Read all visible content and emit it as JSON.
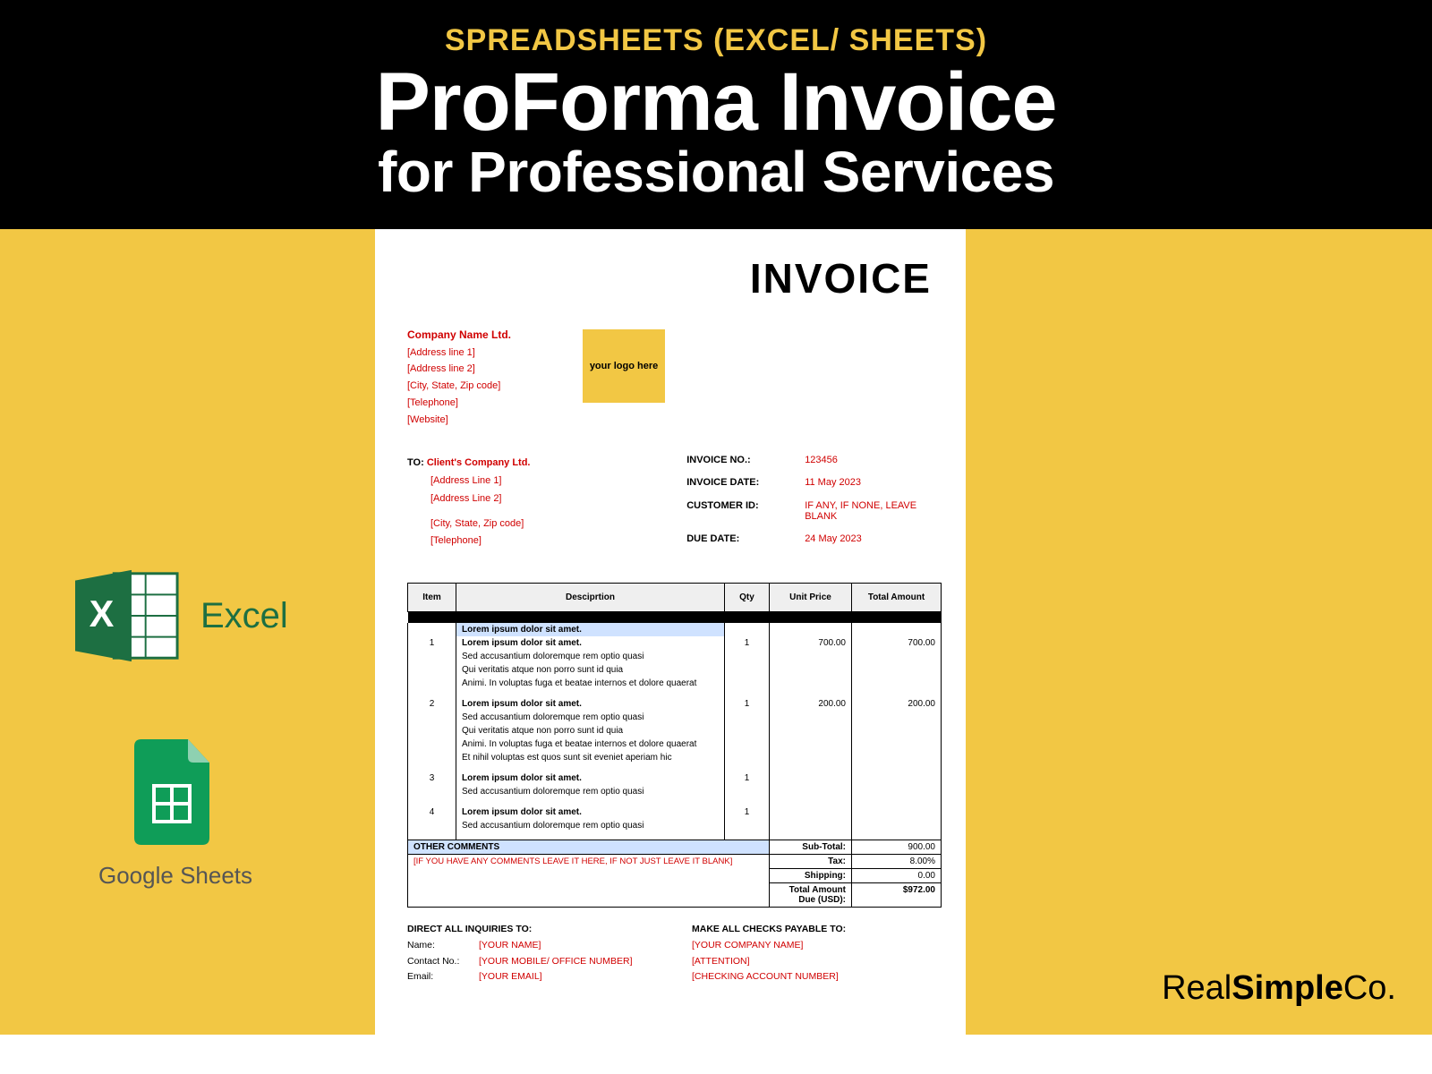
{
  "hero": {
    "eyebrow": "SPREADSHEETS (EXCEL/ SHEETS)",
    "title": "ProForma Invoice",
    "subtitle": "for Professional Services"
  },
  "badges": {
    "excel_label": "Excel",
    "sheets_label": "Google Sheets"
  },
  "invoice": {
    "heading": "INVOICE",
    "company": {
      "name": "Company Name Ltd.",
      "addr1": "[Address line 1]",
      "addr2": "[Address line 2]",
      "city": "[City, State, Zip code]",
      "tel": "[Telephone]",
      "web": "[Website]"
    },
    "logo_text": "your logo here",
    "to_label": "TO:",
    "client": {
      "name": "Client's Company Ltd.",
      "addr1": "[Address Line 1]",
      "addr2": "[Address Line 2]",
      "city": "[City, State, Zip code]",
      "tel": "[Telephone]"
    },
    "meta": {
      "inv_no_lbl": "INVOICE NO.:",
      "inv_no_val": "123456",
      "inv_date_lbl": "INVOICE DATE:",
      "inv_date_val": "11 May 2023",
      "cust_id_lbl": "CUSTOMER ID:",
      "cust_id_val": "IF ANY, IF NONE, LEAVE BLANK",
      "due_lbl": "DUE DATE:",
      "due_val": "24 May 2023"
    },
    "columns": {
      "item": "Item",
      "desc": "Desciprtion",
      "qty": "Qty",
      "price": "Unit Price",
      "total": "Total Amount"
    },
    "rows": [
      {
        "item": "1",
        "header": "Lorem ipsum dolor sit amet.",
        "lines": [
          "Lorem ipsum dolor sit amet.",
          "Sed accusantium doloremque rem optio quasi",
          "Qui veritatis atque non porro sunt id quia",
          "Animi. In voluptas fuga et beatae internos et dolore quaerat"
        ],
        "qty": "1",
        "price": "700.00",
        "total": "700.00"
      },
      {
        "item": "2",
        "header": "Lorem ipsum dolor sit amet.",
        "lines": [
          "Sed accusantium doloremque rem optio quasi",
          "Qui veritatis atque non porro sunt id quia",
          "Animi. In voluptas fuga et beatae internos et dolore quaerat",
          "Et nihil voluptas est quos sunt sit eveniet aperiam hic"
        ],
        "qty": "1",
        "price": "200.00",
        "total": "200.00"
      },
      {
        "item": "3",
        "header": "Lorem ipsum dolor sit amet.",
        "lines": [
          "Sed accusantium doloremque rem optio quasi"
        ],
        "qty": "1",
        "price": "",
        "total": ""
      },
      {
        "item": "4",
        "header": "Lorem ipsum dolor sit amet.",
        "lines": [
          "Sed accusantium doloremque rem optio quasi"
        ],
        "qty": "1",
        "price": "",
        "total": ""
      }
    ],
    "comments_lbl": "OTHER COMMENTS",
    "comments_text": "[IF YOU HAVE ANY COMMENTS LEAVE IT HERE, IF NOT JUST LEAVE IT BLANK]",
    "totals": {
      "subtotal_lbl": "Sub-Total:",
      "subtotal_val": "900.00",
      "tax_lbl": "Tax:",
      "tax_val": "8.00%",
      "ship_lbl": "Shipping:",
      "ship_val": "0.00",
      "due_lbl": "Total Amount Due (USD):",
      "due_val": "$972.00"
    },
    "footer": {
      "inq_heading": "DIRECT ALL INQUIRIES TO:",
      "inq_name_lbl": "Name:",
      "inq_name_val": "[YOUR NAME]",
      "inq_contact_lbl": "Contact No.:",
      "inq_contact_val": "[YOUR MOBILE/ OFFICE NUMBER]",
      "inq_email_lbl": "Email:",
      "inq_email_val": "[YOUR EMAIL]",
      "pay_heading": "MAKE ALL CHECKS PAYABLE TO:",
      "pay_company": "[YOUR COMPANY NAME]",
      "pay_attn": "[ATTENTION]",
      "pay_acct": "[CHECKING ACCOUNT NUMBER]"
    }
  },
  "brand": {
    "a": "Real",
    "b": "Simple",
    "c": "Co."
  }
}
